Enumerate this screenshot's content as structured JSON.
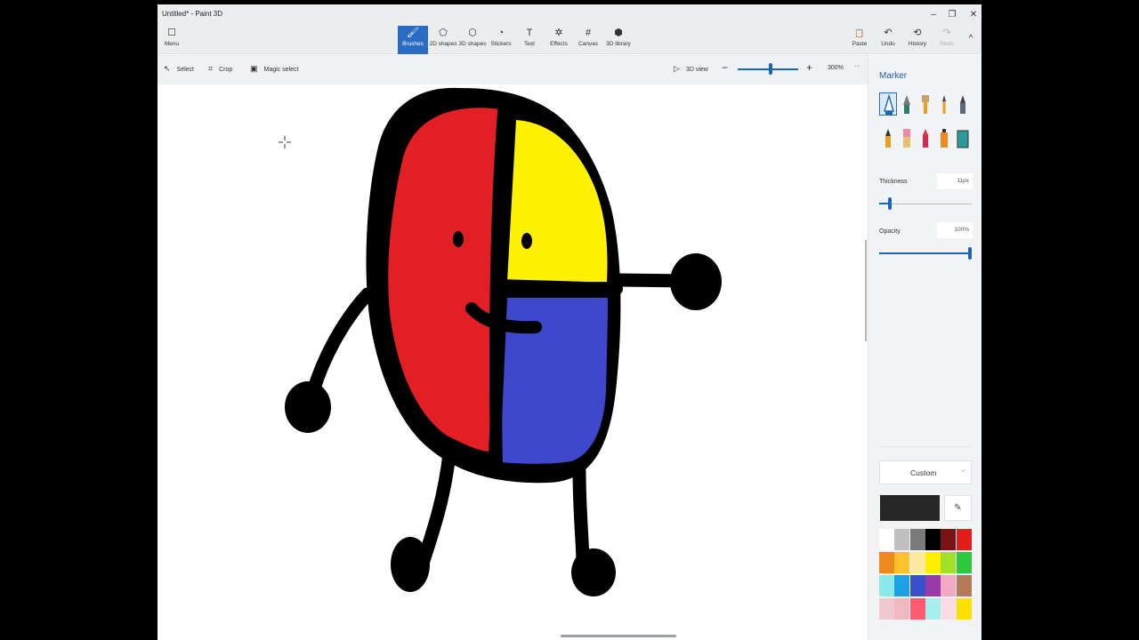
{
  "window": {
    "title": "Untitled* - Paint 3D",
    "controls": [
      "–",
      "❐",
      "✕"
    ]
  },
  "ribbon": {
    "menu": "Menu",
    "tools": [
      {
        "label": "Brushes",
        "icon": "🖌"
      },
      {
        "label": "2D shapes",
        "icon": "⬠"
      },
      {
        "label": "3D shapes",
        "icon": "⬡"
      },
      {
        "label": "Stickers",
        "icon": "◔"
      },
      {
        "label": "Text",
        "icon": "T"
      },
      {
        "label": "Effects",
        "icon": "✲"
      },
      {
        "label": "Canvas",
        "icon": "#"
      },
      {
        "label": "3D library",
        "icon": "⬢"
      }
    ],
    "right": [
      {
        "label": "Paste",
        "icon": "📋"
      },
      {
        "label": "Undo",
        "icon": "↶"
      },
      {
        "label": "History",
        "icon": "⟲"
      },
      {
        "label": "Redo",
        "icon": "↷"
      }
    ],
    "collapse": "^"
  },
  "toolbar": {
    "select": "Select",
    "crop": "Crop",
    "magic": "Magic select",
    "view3d": "3D view",
    "zoom_minus": "−",
    "zoom_plus": "+",
    "zoom": "300%",
    "more": "···"
  },
  "panel": {
    "title": "Marker",
    "brushes": [
      "marker",
      "calligraphy-pen",
      "oil-brush",
      "watercolor",
      "pixel-pen",
      "pencil",
      "eraser",
      "crayon",
      "spray-can",
      "fill"
    ],
    "thickness_label": "Thickness",
    "thickness_value": "11px",
    "opacity_label": "Opacity",
    "opacity_value": "100%",
    "custom_label": "Custom",
    "current_color": "#262626",
    "palette": [
      "#ffffff",
      "#c0c0c0",
      "#7a7a7a",
      "#000000",
      "#7a1414",
      "#e31c1c",
      "#f08a1e",
      "#ffc22a",
      "#fde8a0",
      "#ffee00",
      "#a2e02a",
      "#2ec83c",
      "#8aeaea",
      "#1ea0e6",
      "#3a50c8",
      "#9a3aa8",
      "#f3a8c3",
      "#b47a5a",
      "#f2c8d0",
      "#f0b8c0",
      "#ff5a6e",
      "#a8f0f0",
      "#fcdde7",
      "#ffe000"
    ]
  },
  "drawing": {
    "outline": "#000000",
    "red": "#e31f26",
    "yellow": "#fff200",
    "blue": "#3f48cc"
  }
}
